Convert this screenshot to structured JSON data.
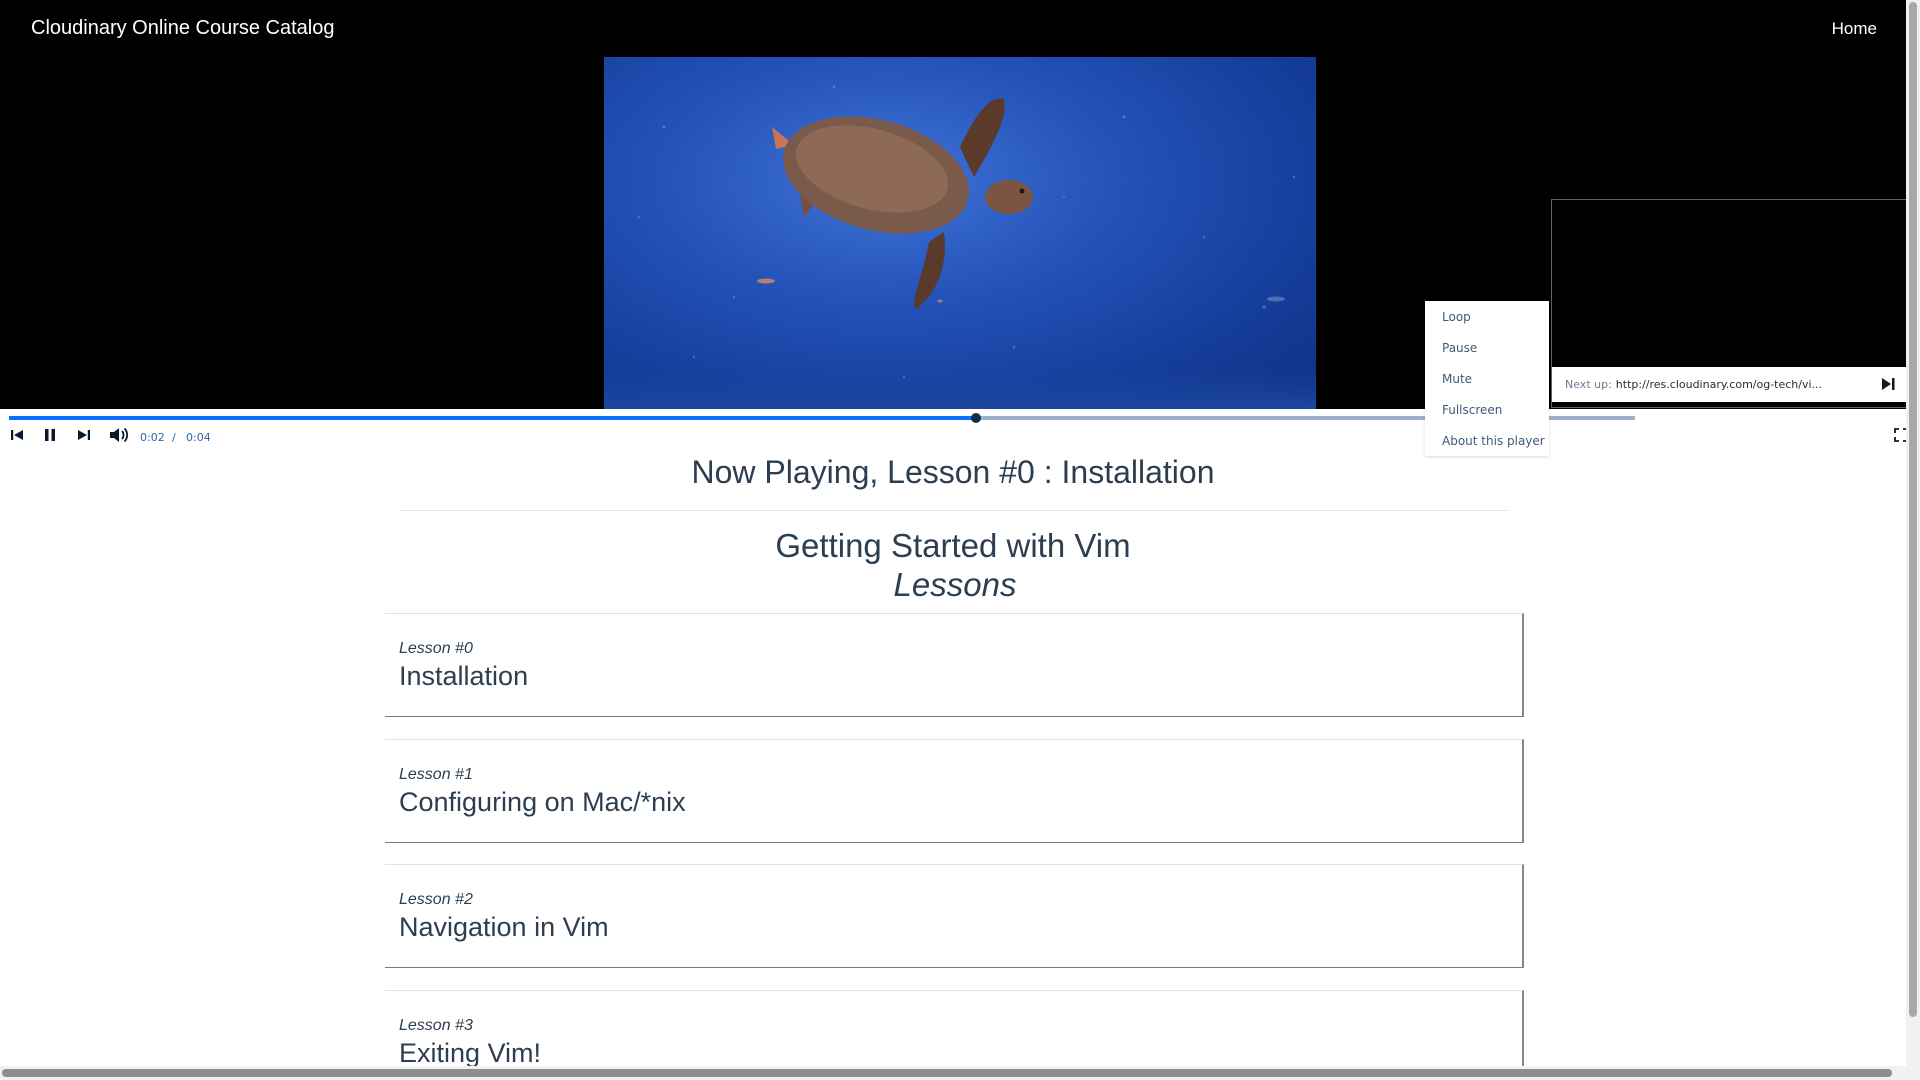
{
  "nav": {
    "brand": "Cloudinary Online Course Catalog",
    "home": "Home"
  },
  "player": {
    "current_time": "0:02",
    "separator": "/",
    "duration": "0:04",
    "played_fraction": 0.595,
    "buffered_fraction": 1.0,
    "context_menu": [
      "Loop",
      "Pause",
      "Mute",
      "Fullscreen",
      "About this player"
    ],
    "next_up": {
      "prefix": "Next up:",
      "url": "http://res.cloudinary.com/og-tech/vi..."
    },
    "icons": [
      "skip-back-icon",
      "pause-icon",
      "skip-forward-icon",
      "volume-icon",
      "fullscreen-icon",
      "next-track-icon"
    ],
    "colors": {
      "accent": "#0c6ffd",
      "handle": "#0b2d4f",
      "time_text": "#3566a8"
    }
  },
  "now_playing": "Now Playing, Lesson #0 : Installation",
  "course": {
    "title": "Getting Started with Vim",
    "lessons_heading": "Lessons",
    "lessons": [
      {
        "number": "Lesson #0",
        "title": "Installation"
      },
      {
        "number": "Lesson #1",
        "title": "Configuring on Mac/*nix"
      },
      {
        "number": "Lesson #2",
        "title": "Navigation in Vim"
      },
      {
        "number": "Lesson #3",
        "title": "Exiting Vim!"
      }
    ]
  }
}
